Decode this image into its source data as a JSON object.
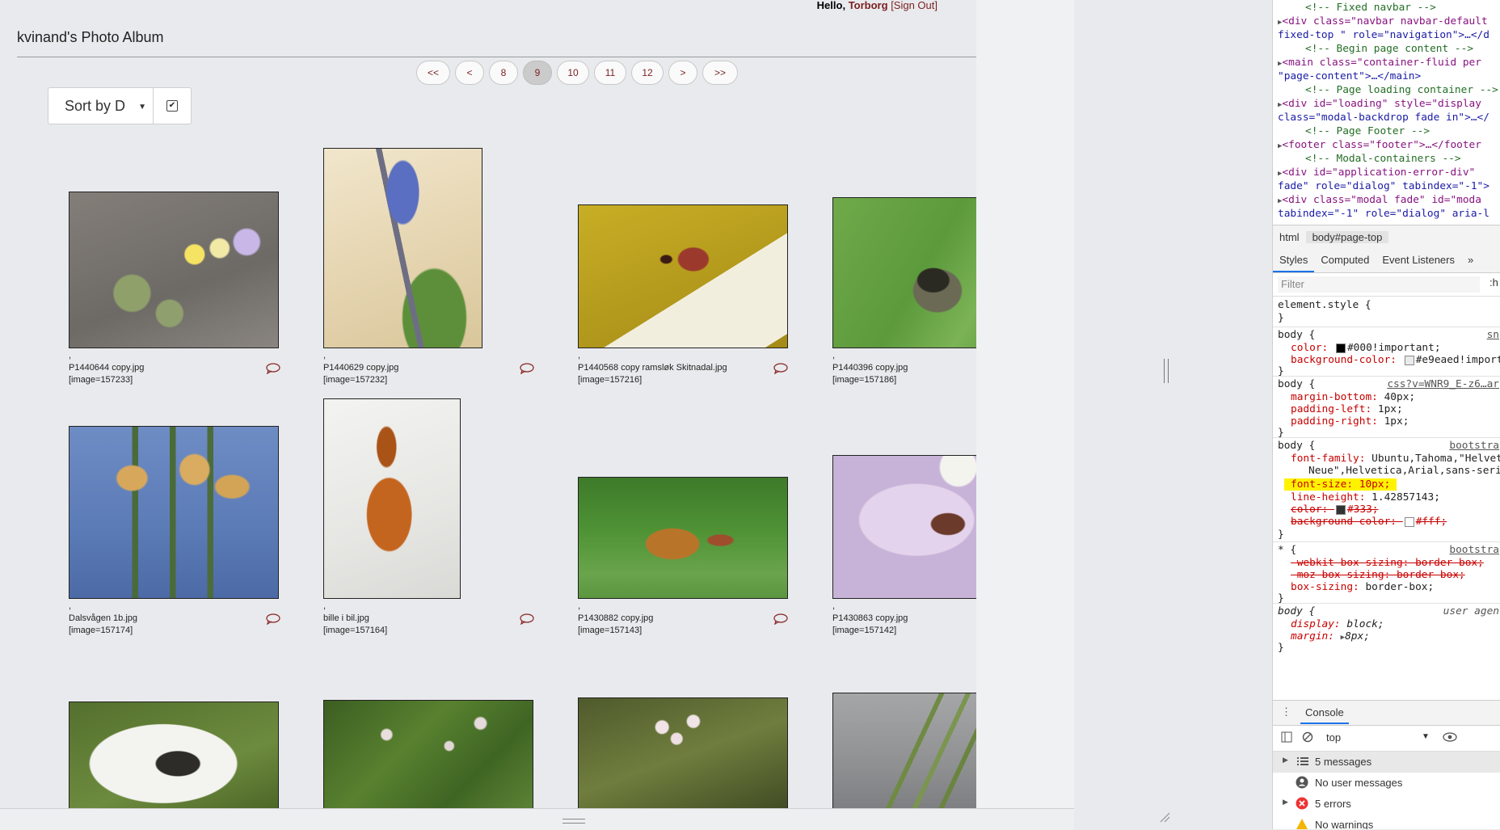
{
  "header": {
    "greeting_prefix": "Hello,",
    "username": "Torborg",
    "sign_out": "[Sign Out]"
  },
  "album": {
    "title": "kvinand's Photo Album"
  },
  "pagination": {
    "items": [
      "<<",
      "<",
      "8",
      "9",
      "10",
      "11",
      "12",
      ">",
      ">>"
    ],
    "active": "9"
  },
  "sort": {
    "selected": "Sort by D",
    "checkbox_checked": true
  },
  "view_icons": [
    "grid-view-icon",
    "list-view-icon",
    "detail-view-icon",
    "filmstrip-view-icon"
  ],
  "photos": [
    {
      "comma": ",",
      "filename": "P1440644 copy.jpg",
      "id": "[image=157233]"
    },
    {
      "comma": ",",
      "filename": "P1440629 copy.jpg",
      "id": "[image=157232]"
    },
    {
      "comma": ",",
      "filename": "P1440568 copy ramsløk Skitnadal.jpg",
      "id": "[image=157216]"
    },
    {
      "comma": ",",
      "filename": "P1440396 copy.jpg",
      "id": "[image=157186]"
    },
    {
      "comma": ",",
      "filename": "Dalsvågen 1b.jpg",
      "id": "[image=157174]"
    },
    {
      "comma": ",",
      "filename": "bille i bil.jpg",
      "id": "[image=157164]"
    },
    {
      "comma": ",",
      "filename": "P1430882 copy.jpg",
      "id": "[image=157143]"
    },
    {
      "comma": ",",
      "filename": "P1430863 copy.jpg",
      "id": "[image=157142]"
    }
  ],
  "devtools": {
    "elements": [
      {
        "type": "comment",
        "text": "<!-- Fixed navbar -->"
      },
      {
        "type": "node",
        "text": "<div class=\"navbar navbar-default"
      },
      {
        "type": "cont",
        "text": "fixed-top \" role=\"navigation\">…</d"
      },
      {
        "type": "comment",
        "text": "<!-- Begin page content -->"
      },
      {
        "type": "node",
        "text": "<main class=\"container-fluid per"
      },
      {
        "type": "cont",
        "text": "\"page-content\">…</main>"
      },
      {
        "type": "comment",
        "text": "<!-- Page loading container -->"
      },
      {
        "type": "node",
        "text": "<div id=\"loading\" style=\"display"
      },
      {
        "type": "cont",
        "text": "class=\"modal-backdrop fade in\">…</"
      },
      {
        "type": "comment",
        "text": "<!-- Page Footer -->"
      },
      {
        "type": "node",
        "text": "<footer class=\"footer\">…</footer"
      },
      {
        "type": "comment",
        "text": "<!-- Modal-containers -->"
      },
      {
        "type": "node",
        "text": "<div id=\"application-error-div\""
      },
      {
        "type": "cont",
        "text": "fade\" role=\"dialog\" tabindex=\"-1\">"
      },
      {
        "type": "node",
        "text": "<div class=\"modal fade\" id=\"moda"
      },
      {
        "type": "cont",
        "text": "tabindex=\"-1\" role=\"dialog\" aria-l"
      }
    ],
    "breadcrumbs": [
      "html",
      "body#page-top"
    ],
    "tabs": [
      "Styles",
      "Computed",
      "Event Listeners",
      "»"
    ],
    "active_tab": "Styles",
    "filter_placeholder": "Filter",
    "hov": ":h",
    "rules": {
      "element_style": "element.style {",
      "close": "}",
      "r1_selector": "body {",
      "r1_source": "sn",
      "r1_color": "color:",
      "r1_color_val": "#000!important;",
      "r1_bg": "background-color:",
      "r1_bg_val": "#e9eaed!importa",
      "r2_selector": "body {",
      "r2_source": "css?v=WNR9_E-z6…ar",
      "r2_mb": "margin-bottom:",
      "r2_mb_val": "40px;",
      "r2_pl": "padding-left:",
      "r2_pl_val": "1px;",
      "r2_pr": "padding-right:",
      "r2_pr_val": "1px;",
      "r3_selector": "body {",
      "r3_source": "bootstra",
      "r3_ff": "font-family:",
      "r3_ff_val": "Ubuntu,Tahoma,\"Helveti",
      "r3_ff_val2": "Neue\",Helvetica,Arial,sans-serif",
      "r3_fs": "font-size: 10px;",
      "r3_lh": "line-height:",
      "r3_lh_val": "1.42857143;",
      "r3_color": "color:",
      "r3_color_val": "#333;",
      "r3_bg": "background-color:",
      "r3_bg_val": "#fff;",
      "r4_selector": "* {",
      "r4_source": "bootstra",
      "r4_wk": "-webkit-box-sizing: border-box;",
      "r4_moz": "-moz-box-sizing: border-box;",
      "r4_bs": "box-sizing:",
      "r4_bs_val": "border-box;",
      "r5_selector": "body {",
      "r5_source": "user agen",
      "r5_d": "display:",
      "r5_d_val": "block;",
      "r5_m": "margin:",
      "r5_m_val": "8px;"
    },
    "console": {
      "title": "Console",
      "context": "top",
      "rows": [
        "5 messages",
        "No user messages",
        "5 errors",
        "No warnings"
      ]
    }
  },
  "colors": {
    "accent": "#7a1f1f",
    "page_bg": "#e9eaed",
    "devtools_blue": "#1a73e8",
    "highlight": "#fff200"
  }
}
